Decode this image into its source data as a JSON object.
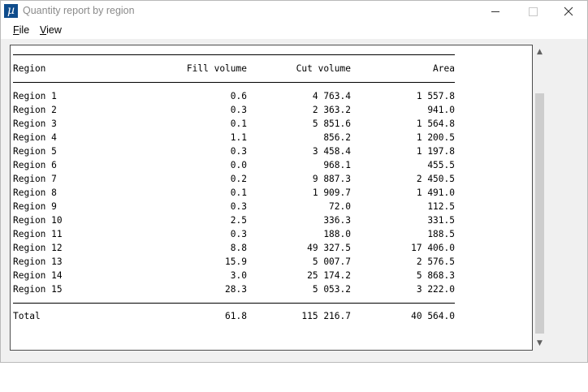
{
  "window": {
    "title": "Quantity report by region",
    "app_icon_glyph": "µ",
    "icons": {
      "minimize": "minimize-icon",
      "maximize": "maximize-icon",
      "close": "close-icon"
    }
  },
  "menu": {
    "file": {
      "accel": "F",
      "rest": "ile"
    },
    "view": {
      "accel": "V",
      "rest": "iew"
    }
  },
  "report": {
    "headers": [
      "Region",
      "Fill volume",
      "Cut volume",
      "Area"
    ],
    "rows": [
      [
        "Region 1",
        "0.6",
        "4 763.4",
        "1 557.8"
      ],
      [
        "Region 2",
        "0.3",
        "2 363.2",
        "941.0"
      ],
      [
        "Region 3",
        "0.1",
        "5 851.6",
        "1 564.8"
      ],
      [
        "Region 4",
        "1.1",
        "856.2",
        "1 200.5"
      ],
      [
        "Region 5",
        "0.3",
        "3 458.4",
        "1 197.8"
      ],
      [
        "Region 6",
        "0.0",
        "968.1",
        "455.5"
      ],
      [
        "Region 7",
        "0.2",
        "9 887.3",
        "2 450.5"
      ],
      [
        "Region 8",
        "0.1",
        "1 909.7",
        "1 491.0"
      ],
      [
        "Region 9",
        "0.3",
        "72.0",
        "112.5"
      ],
      [
        "Region 10",
        "2.5",
        "336.3",
        "331.5"
      ],
      [
        "Region 11",
        "0.3",
        "188.0",
        "188.5"
      ],
      [
        "Region 12",
        "8.8",
        "49 327.5",
        "17 406.0"
      ],
      [
        "Region 13",
        "15.9",
        "5 007.7",
        "2 576.5"
      ],
      [
        "Region 14",
        "3.0",
        "25 174.2",
        "5 868.3"
      ],
      [
        "Region 15",
        "28.3",
        "5 053.2",
        "3 222.0"
      ]
    ],
    "total": [
      "Total",
      "61.8",
      "115 216.7",
      "40 564.0"
    ]
  },
  "scrollbar": {
    "up_glyph": "▲",
    "down_glyph": "▼",
    "position_fraction": 0.0,
    "visible_fraction": 0.85
  }
}
